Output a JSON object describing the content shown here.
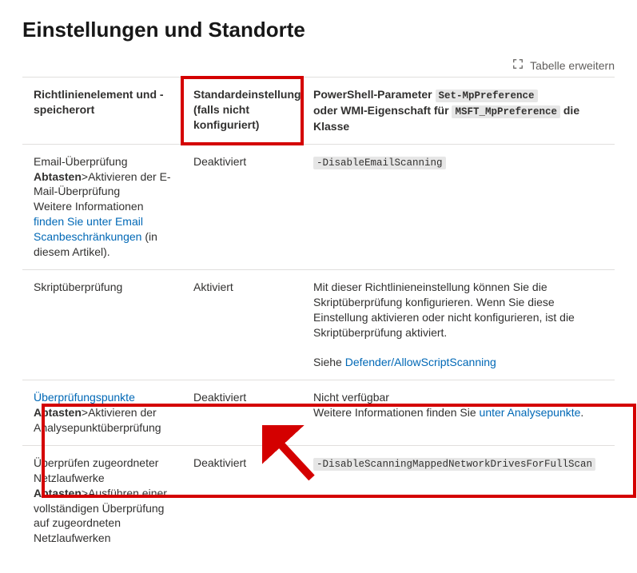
{
  "page": {
    "title": "Einstellungen und Standorte"
  },
  "toolbar": {
    "expand_label": "Tabelle erweitern"
  },
  "table": {
    "headers": {
      "col1": "Richtlinienelement und -speicherort",
      "col2": "Standardeinstellung (falls nicht konfiguriert)",
      "col3_pre": "PowerShell-Parameter ",
      "col3_code1": "Set-MpPreference",
      "col3_mid": "oder WMI-Eigenschaft für ",
      "col3_code2": "MSFT_MpPreference",
      "col3_post": " die Klasse"
    },
    "rows": [
      {
        "c1_line1": "Email-Überprüfung",
        "c1_line2_bold_pre": "Abtasten",
        "c1_line2_after": ">Aktivieren der E-Mail-Überprüfung",
        "c1_line3_pre": "Weitere Informationen ",
        "c1_line3_link": "finden Sie unter Email Scanbeschränkungen",
        "c1_line3_post": " (in diesem Artikel).",
        "c2": "Deaktiviert",
        "c3_code": "-DisableEmailScanning"
      },
      {
        "c1_line1": "Skriptüberprüfung",
        "c2": "Aktiviert",
        "c3_text": "Mit dieser Richtlinieneinstellung können Sie die Skriptüberprüfung konfigurieren. Wenn Sie diese Einstellung aktivieren oder nicht konfigurieren, ist die Skriptüberprüfung aktiviert.",
        "c3_see_pre": "Siehe ",
        "c3_see_link": "Defender/AllowScriptScanning"
      },
      {
        "c1_link": "Überprüfungspunkte",
        "c1_line2_bold_pre": "Abtasten",
        "c1_line2_after": ">Aktivieren der Analysepunktüberprüfung",
        "c2": "Deaktiviert",
        "c3_line1": "Nicht verfügbar",
        "c3_line2_pre": "Weitere Informationen finden Sie ",
        "c3_line2_link": "unter Analysepunkte",
        "c3_line2_post": "."
      },
      {
        "c1_line1": "Überprüfen zugeordneter Netzlaufwerke",
        "c1_line2_bold_pre": "Abtasten",
        "c1_line2_after": ">Ausführen einer vollständigen Überprüfung auf zugeordneten Netzlaufwerken",
        "c2": "Deaktiviert",
        "c3_code": "-DisableScanningMappedNetworkDrivesForFullScan"
      }
    ]
  }
}
